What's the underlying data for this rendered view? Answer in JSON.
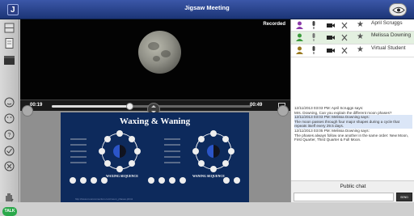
{
  "header": {
    "title": "Jigsaw Meeting",
    "app_icon": "jigsaw-logo-icon",
    "eye_icon": "eye-icon"
  },
  "video": {
    "status": "Recorded",
    "time_elapsed": "00:19",
    "time_total": "00:49",
    "progress": 0.39
  },
  "slide": {
    "title": "Waxing & Waning",
    "subtitle_left": "WAXING SEQUENCE",
    "subtitle_right": "WANING SEQUENCE",
    "url": "http://www.moonconnection.com/moon_phases.phtml"
  },
  "participants": [
    {
      "name": "April Scruggs",
      "icon": "teacher-icon",
      "color": "#8b3aa9"
    },
    {
      "name": "Melissa Downing",
      "icon": "student-icon",
      "color": "#3b9a3b"
    },
    {
      "name": "Virtual Student",
      "icon": "student-icon",
      "color": "#9a7a20"
    }
  ],
  "chat": {
    "messages": [
      {
        "header": "12/11/2013 03:03 PM: April Scruggs says:",
        "text": "Mrs. Downing, Can you explain the different moon phases?",
        "highlight": false
      },
      {
        "header": "12/11/2013 03:03 PM: Melissa Downing says:",
        "text": "The moon passes through four major shapes during a cycle that repeats itself every 29.5 days.",
        "highlight": true
      },
      {
        "header": "12/11/2013 03:05 PM: Melissa Downing says:",
        "text": "The phases always follow one another in the same order: New Moon, First Quarter, Third Quarter & Full Moon.",
        "highlight": false
      }
    ],
    "public_chat_label": "Public chat",
    "send_label": "SEND"
  },
  "leftbar": {
    "talk_label": "TALK"
  }
}
